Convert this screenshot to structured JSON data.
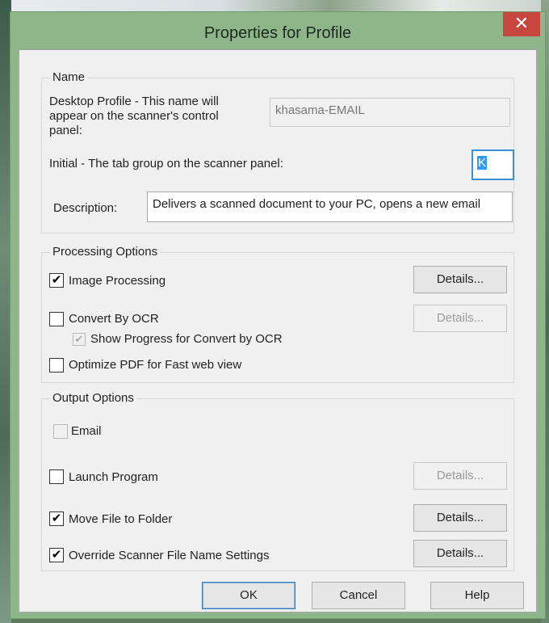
{
  "window": {
    "title": "Properties for Profile",
    "close_symbol": "✕"
  },
  "name_group": {
    "label": "Name",
    "desktop_profile_label": "Desktop Profile - This name will appear on the scanner's control panel:",
    "desktop_profile_value": "khasama-EMAIL",
    "initial_label": "Initial - The tab group on the scanner panel:",
    "initial_value": "K",
    "description_label": "Description:",
    "description_value": "Delivers a scanned document to your PC, opens a new email"
  },
  "processing_group": {
    "label": "Processing Options",
    "image_processing": {
      "label": "Image Processing",
      "checked": true
    },
    "convert_ocr": {
      "label": "Convert By OCR",
      "checked": false
    },
    "show_progress": {
      "label": "Show Progress for Convert by OCR",
      "checked": true,
      "disabled": true
    },
    "optimize_pdf": {
      "label": "Optimize PDF for Fast web view",
      "checked": false
    },
    "details_label": "Details..."
  },
  "output_group": {
    "label": "Output Options",
    "email": {
      "label": "Email",
      "checked": false,
      "disabled": true
    },
    "launch_program": {
      "label": "Launch Program",
      "checked": false
    },
    "move_file": {
      "label": "Move File to Folder",
      "checked": true
    },
    "override_name": {
      "label": "Override Scanner File Name Settings",
      "checked": true
    },
    "details_label": "Details..."
  },
  "footer": {
    "ok_label": "OK",
    "cancel_label": "Cancel",
    "help_label": "Help"
  },
  "colors": {
    "title_bar": "#8fb58a",
    "close": "#c7463e",
    "dialog_bg": "#f0f0f0",
    "selection": "#3399ff"
  },
  "icons": {
    "check": "✔"
  }
}
